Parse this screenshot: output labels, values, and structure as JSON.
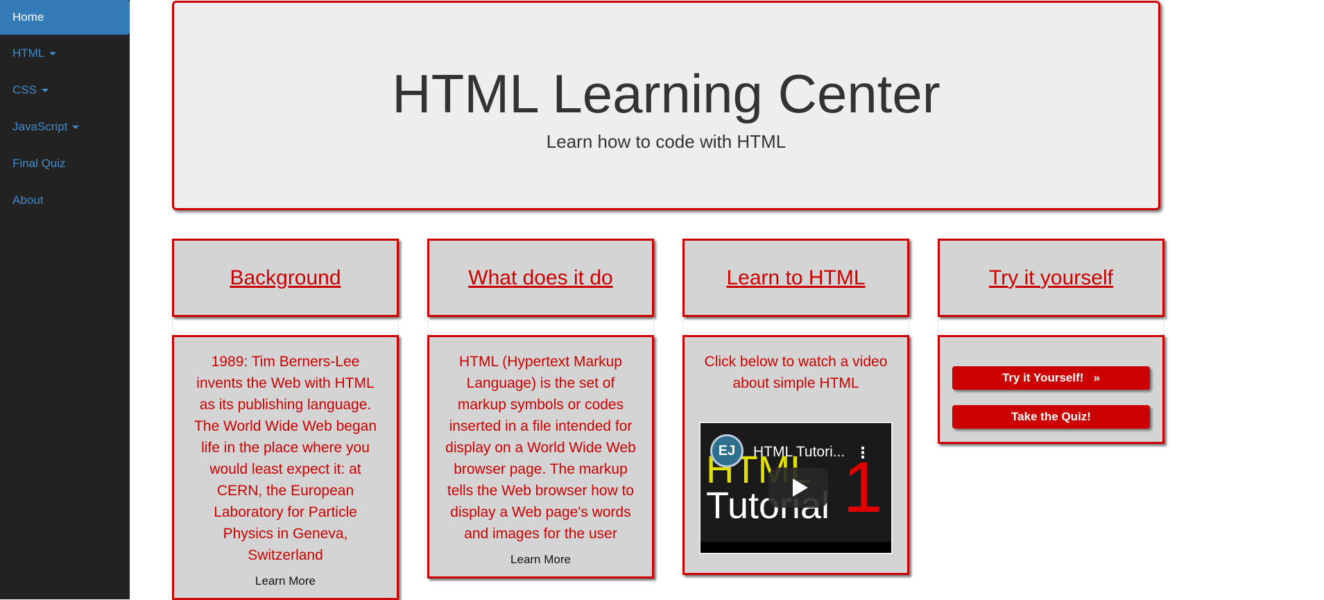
{
  "nav": {
    "items": [
      {
        "label": "Home",
        "caret": false
      },
      {
        "label": "HTML",
        "caret": true
      },
      {
        "label": "CSS",
        "caret": true
      },
      {
        "label": "JavaScript",
        "caret": true
      },
      {
        "label": "Final Quiz",
        "caret": false
      },
      {
        "label": "About",
        "caret": false
      }
    ]
  },
  "hero": {
    "title": "HTML Learning Center",
    "subtitle": "Learn how to code with HTML"
  },
  "columns": [
    {
      "heading": "Background",
      "text": "1989: Tim Berners-Lee invents the Web with HTML as its publishing language. The World Wide Web began life in the place where you would least expect it: at CERN, the European Laboratory for Particle Physics in Geneva, Switzerland",
      "link": "Learn More"
    },
    {
      "heading": "What does it do",
      "text": "HTML (Hypertext Markup Language) is the set of markup symbols or codes inserted in a file intended for display on a World Wide Web browser page. The markup tells the Web browser how to display a Web page's words and images for the user",
      "link": "Learn More"
    },
    {
      "heading": "Learn to HTML",
      "text": "Click below to watch a video about simple HTML",
      "video": {
        "title": "HTML Tutori...",
        "thumb_line1": "HTML",
        "thumb_line2": "Tutorial",
        "thumb_number": "1",
        "channel_logo": "EJ"
      }
    },
    {
      "heading": "Try it yourself",
      "button_try": "Try it Yourself!   »",
      "button_quiz": "Take the Quiz!"
    }
  ],
  "colors": {
    "accent": "#cc0000",
    "sidebar_bg": "#222222",
    "nav_link": "#428bca",
    "active_bg": "#337ab7"
  }
}
